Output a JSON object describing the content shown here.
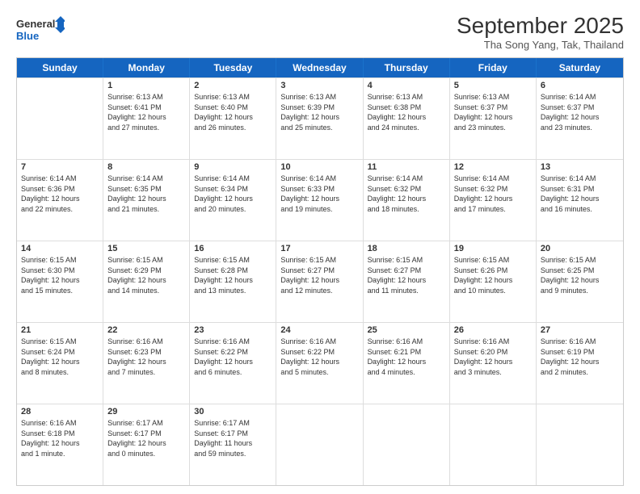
{
  "logo": {
    "line1": "General",
    "line2": "Blue"
  },
  "title": "September 2025",
  "subtitle": "Tha Song Yang, Tak, Thailand",
  "days": [
    "Sunday",
    "Monday",
    "Tuesday",
    "Wednesday",
    "Thursday",
    "Friday",
    "Saturday"
  ],
  "weeks": [
    [
      {
        "day": "",
        "info": ""
      },
      {
        "day": "1",
        "info": "Sunrise: 6:13 AM\nSunset: 6:41 PM\nDaylight: 12 hours\nand 27 minutes."
      },
      {
        "day": "2",
        "info": "Sunrise: 6:13 AM\nSunset: 6:40 PM\nDaylight: 12 hours\nand 26 minutes."
      },
      {
        "day": "3",
        "info": "Sunrise: 6:13 AM\nSunset: 6:39 PM\nDaylight: 12 hours\nand 25 minutes."
      },
      {
        "day": "4",
        "info": "Sunrise: 6:13 AM\nSunset: 6:38 PM\nDaylight: 12 hours\nand 24 minutes."
      },
      {
        "day": "5",
        "info": "Sunrise: 6:13 AM\nSunset: 6:37 PM\nDaylight: 12 hours\nand 23 minutes."
      },
      {
        "day": "6",
        "info": "Sunrise: 6:14 AM\nSunset: 6:37 PM\nDaylight: 12 hours\nand 23 minutes."
      }
    ],
    [
      {
        "day": "7",
        "info": "Sunrise: 6:14 AM\nSunset: 6:36 PM\nDaylight: 12 hours\nand 22 minutes."
      },
      {
        "day": "8",
        "info": "Sunrise: 6:14 AM\nSunset: 6:35 PM\nDaylight: 12 hours\nand 21 minutes."
      },
      {
        "day": "9",
        "info": "Sunrise: 6:14 AM\nSunset: 6:34 PM\nDaylight: 12 hours\nand 20 minutes."
      },
      {
        "day": "10",
        "info": "Sunrise: 6:14 AM\nSunset: 6:33 PM\nDaylight: 12 hours\nand 19 minutes."
      },
      {
        "day": "11",
        "info": "Sunrise: 6:14 AM\nSunset: 6:32 PM\nDaylight: 12 hours\nand 18 minutes."
      },
      {
        "day": "12",
        "info": "Sunrise: 6:14 AM\nSunset: 6:32 PM\nDaylight: 12 hours\nand 17 minutes."
      },
      {
        "day": "13",
        "info": "Sunrise: 6:14 AM\nSunset: 6:31 PM\nDaylight: 12 hours\nand 16 minutes."
      }
    ],
    [
      {
        "day": "14",
        "info": "Sunrise: 6:15 AM\nSunset: 6:30 PM\nDaylight: 12 hours\nand 15 minutes."
      },
      {
        "day": "15",
        "info": "Sunrise: 6:15 AM\nSunset: 6:29 PM\nDaylight: 12 hours\nand 14 minutes."
      },
      {
        "day": "16",
        "info": "Sunrise: 6:15 AM\nSunset: 6:28 PM\nDaylight: 12 hours\nand 13 minutes."
      },
      {
        "day": "17",
        "info": "Sunrise: 6:15 AM\nSunset: 6:27 PM\nDaylight: 12 hours\nand 12 minutes."
      },
      {
        "day": "18",
        "info": "Sunrise: 6:15 AM\nSunset: 6:27 PM\nDaylight: 12 hours\nand 11 minutes."
      },
      {
        "day": "19",
        "info": "Sunrise: 6:15 AM\nSunset: 6:26 PM\nDaylight: 12 hours\nand 10 minutes."
      },
      {
        "day": "20",
        "info": "Sunrise: 6:15 AM\nSunset: 6:25 PM\nDaylight: 12 hours\nand 9 minutes."
      }
    ],
    [
      {
        "day": "21",
        "info": "Sunrise: 6:15 AM\nSunset: 6:24 PM\nDaylight: 12 hours\nand 8 minutes."
      },
      {
        "day": "22",
        "info": "Sunrise: 6:16 AM\nSunset: 6:23 PM\nDaylight: 12 hours\nand 7 minutes."
      },
      {
        "day": "23",
        "info": "Sunrise: 6:16 AM\nSunset: 6:22 PM\nDaylight: 12 hours\nand 6 minutes."
      },
      {
        "day": "24",
        "info": "Sunrise: 6:16 AM\nSunset: 6:22 PM\nDaylight: 12 hours\nand 5 minutes."
      },
      {
        "day": "25",
        "info": "Sunrise: 6:16 AM\nSunset: 6:21 PM\nDaylight: 12 hours\nand 4 minutes."
      },
      {
        "day": "26",
        "info": "Sunrise: 6:16 AM\nSunset: 6:20 PM\nDaylight: 12 hours\nand 3 minutes."
      },
      {
        "day": "27",
        "info": "Sunrise: 6:16 AM\nSunset: 6:19 PM\nDaylight: 12 hours\nand 2 minutes."
      }
    ],
    [
      {
        "day": "28",
        "info": "Sunrise: 6:16 AM\nSunset: 6:18 PM\nDaylight: 12 hours\nand 1 minute."
      },
      {
        "day": "29",
        "info": "Sunrise: 6:17 AM\nSunset: 6:17 PM\nDaylight: 12 hours\nand 0 minutes."
      },
      {
        "day": "30",
        "info": "Sunrise: 6:17 AM\nSunset: 6:17 PM\nDaylight: 11 hours\nand 59 minutes."
      },
      {
        "day": "",
        "info": ""
      },
      {
        "day": "",
        "info": ""
      },
      {
        "day": "",
        "info": ""
      },
      {
        "day": "",
        "info": ""
      }
    ]
  ]
}
